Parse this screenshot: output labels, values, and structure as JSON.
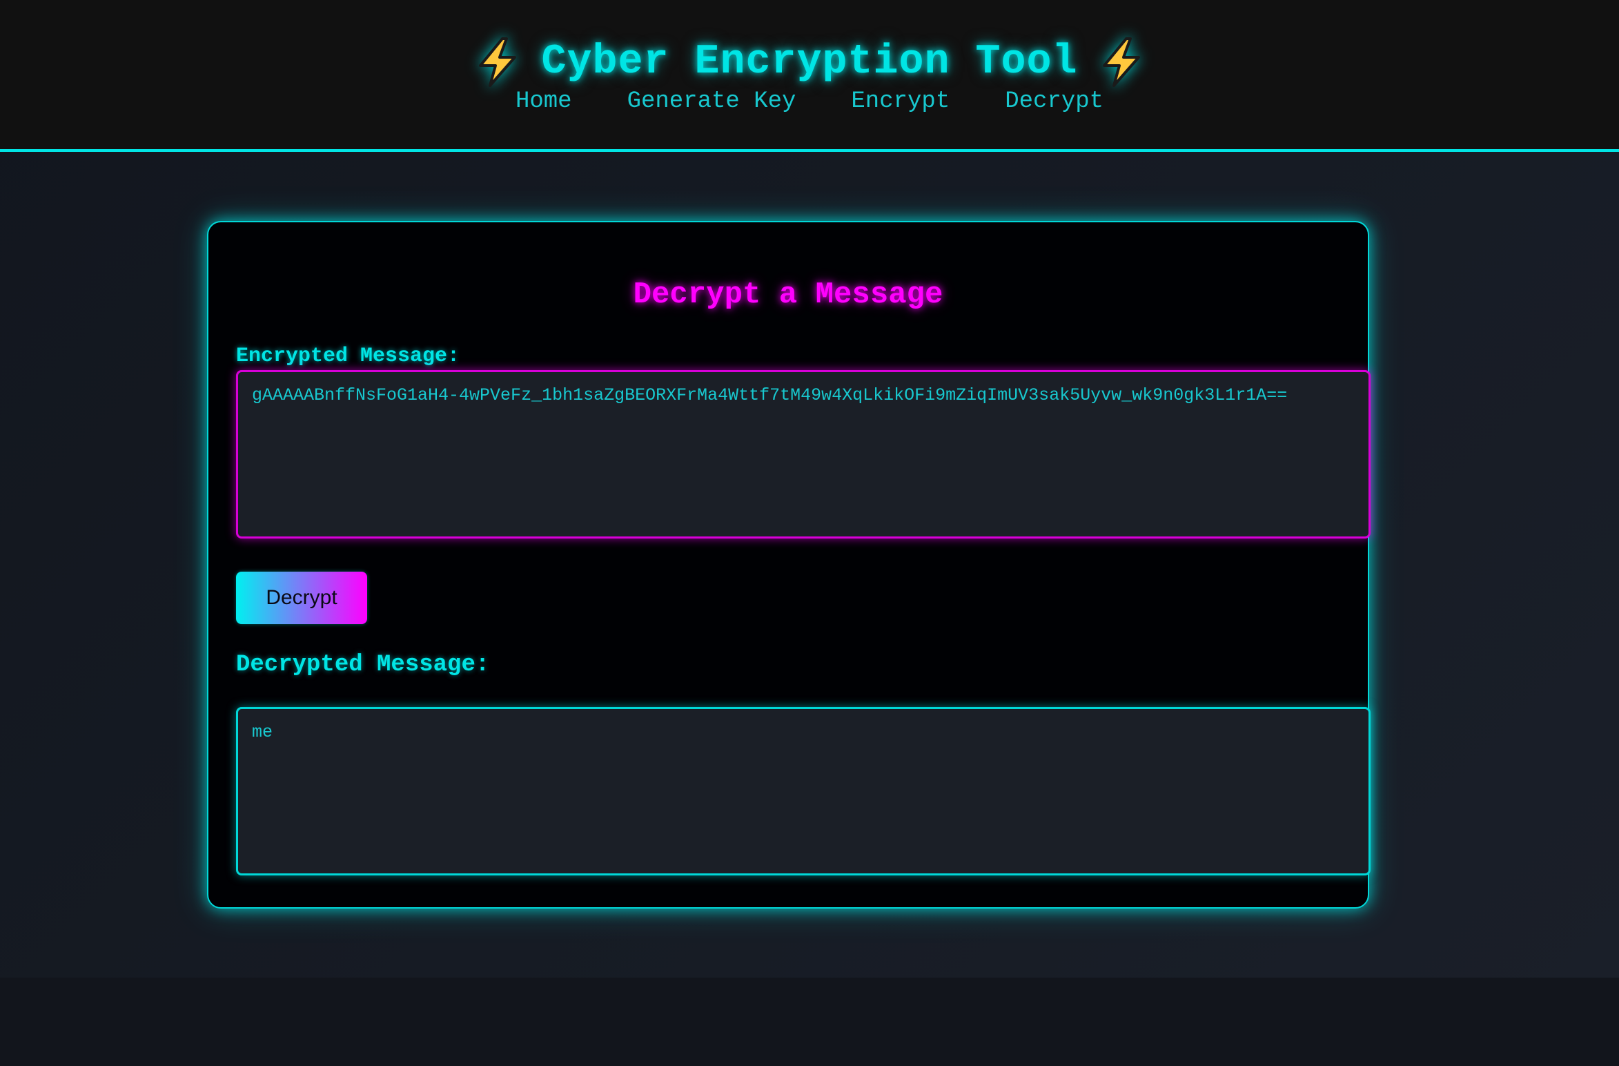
{
  "header": {
    "title": "Cyber Encryption Tool",
    "icon_left": "lightning-bolt-icon",
    "icon_right": "lightning-bolt-icon",
    "nav": {
      "home": "Home",
      "generate_key": "Generate Key",
      "encrypt": "Encrypt",
      "decrypt": "Decrypt"
    }
  },
  "card": {
    "title": "Decrypt a Message",
    "encrypted_label": "Encrypted Message:",
    "encrypted_value": "gAAAAABnffNsFoG1aH4-4wPVeFz_1bh1saZgBEORXFrMa4Wttf7tM49w4XqLkikOFi9mZiqImUV3sak5Uyvw_wk9n0gk3L1r1A==",
    "decrypt_button": "Decrypt",
    "decrypted_label": "Decrypted Message:",
    "decrypted_value": "me"
  },
  "colors": {
    "accent_cyan": "#00e5e5",
    "accent_magenta": "#ff00ff",
    "header_bg": "#111111",
    "card_bg": "#000104",
    "field_bg": "#1b1f27"
  }
}
